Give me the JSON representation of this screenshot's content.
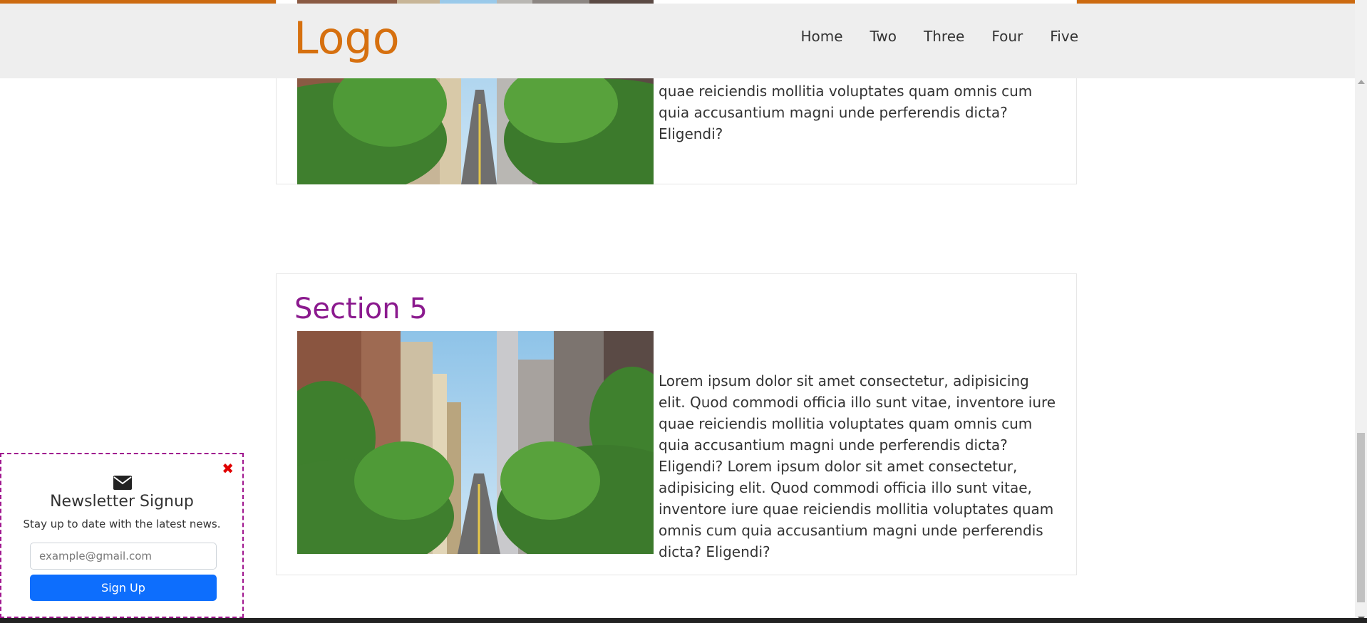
{
  "header": {
    "logo": "Logo",
    "nav": [
      "Home",
      "Two",
      "Three",
      "Four",
      "Five"
    ],
    "accent_color": "#cc6a10",
    "logo_color": "#d6700f"
  },
  "sections": [
    {
      "title": "",
      "text": "Quod commodi officia illo sunt vitae, inventore iure quae reiciendis mollitia voluptates quam omnis cum quia accusantium magni unde perferendis dicta? Eligendi?"
    },
    {
      "title": "Section 5",
      "title_color": "#8b1a8e",
      "text": "Lorem ipsum dolor sit amet consectetur, adipisicing elit. Quod commodi officia illo sunt vitae, inventore iure quae reiciendis mollitia voluptates quam omnis cum quia accusantium magni unde perferendis dicta? Eligendi? Lorem ipsum dolor sit amet consectetur, adipisicing elit. Quod commodi officia illo sunt vitae, inventore iure quae reiciendis mollitia voluptates quam omnis cum quia accusantium magni unde perferendis dicta? Eligendi?"
    }
  ],
  "newsletter": {
    "icon": "envelope-icon",
    "close_icon": "close-icon",
    "title": "Newsletter Signup",
    "subtitle": "Stay up to date with the latest news.",
    "email_placeholder": "example@gmail.com",
    "email_value": "",
    "button_label": "Sign Up",
    "button_color": "#0d6efd",
    "border_color": "#a0178f"
  }
}
